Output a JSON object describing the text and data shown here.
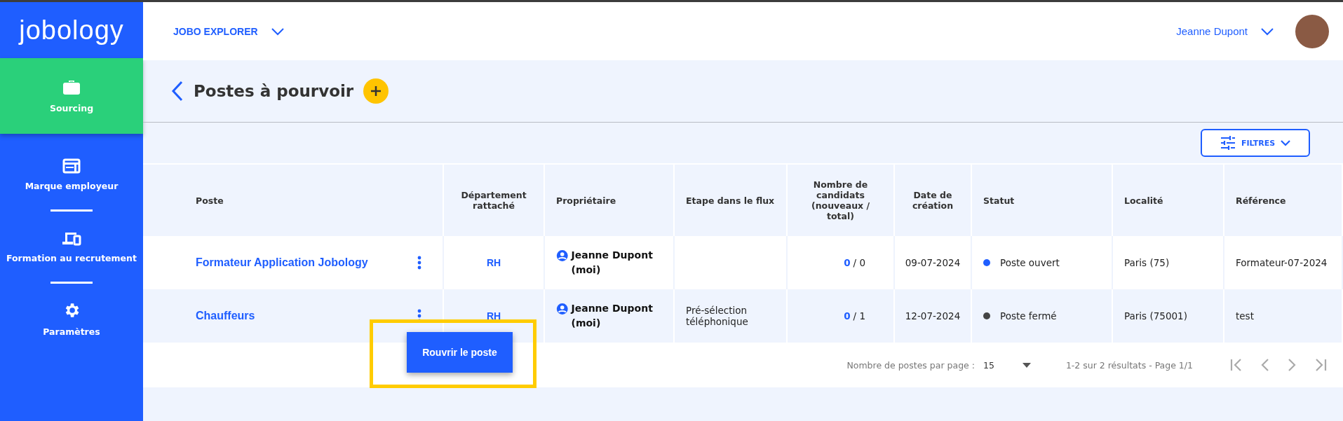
{
  "logo": "jobology",
  "sidebar": {
    "items": [
      {
        "label": "Sourcing",
        "kind": "briefcase",
        "selected": true
      },
      {
        "label": "Marque employeur",
        "kind": "browser",
        "selected": false
      },
      {
        "label": "Formation au recrutement",
        "kind": "devices",
        "selected": false
      },
      {
        "label": "Paramètres",
        "kind": "gear",
        "selected": false
      }
    ]
  },
  "header": {
    "workspace": "JOBO EXPLORER",
    "user_name": "Jeanne Dupont"
  },
  "page": {
    "title": "Postes à pourvoir",
    "filter_button": "FILTRES"
  },
  "table": {
    "columns": [
      "Poste",
      "Département rattaché",
      "Propriétaire",
      "Etape dans le flux",
      "Nombre de candidats (nouveaux / total)",
      "Date de création",
      "Statut",
      "Localité",
      "Référence"
    ],
    "rows": [
      {
        "poste": "Formateur Application Jobology",
        "departement": "RH",
        "proprietaire": "Jeanne Dupont (moi)",
        "etape": "",
        "candidats_nouveaux": "0",
        "candidats_total": "/ 0",
        "date": "09-07-2024",
        "statut": {
          "label": "Poste ouvert",
          "color": "#1f5eff"
        },
        "localite": "Paris (75)",
        "reference": "Formateur-07-2024"
      },
      {
        "poste": "Chauffeurs",
        "departement": "RH",
        "proprietaire": "Jeanne Dupont (moi)",
        "etape": "Pré-sélection téléphonique",
        "candidats_nouveaux": "0",
        "candidats_total": "/ 1",
        "date": "12-07-2024",
        "statut": {
          "label": "Poste fermé",
          "color": "#444444"
        },
        "localite": "Paris (75001)",
        "reference": "test"
      }
    ]
  },
  "pagination": {
    "per_page_label": "Nombre de postes par page :",
    "per_page_value": "15",
    "range": "1-2 sur 2 résultats - Page 1/1"
  },
  "context_menu": {
    "item": "Rouvrir le poste"
  }
}
